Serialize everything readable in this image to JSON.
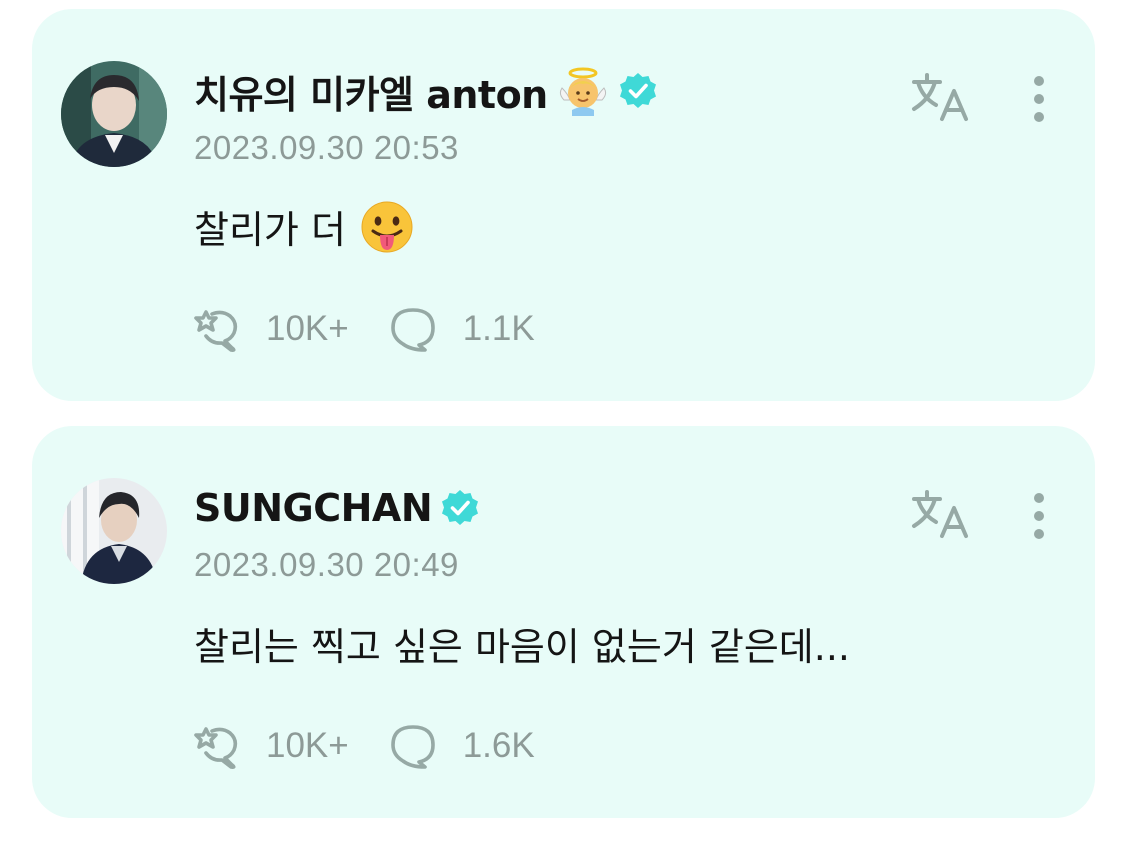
{
  "colors": {
    "card_bg": "#e8fcf8",
    "text_primary": "#151515",
    "text_secondary": "#8d9a97",
    "verified": "#3fd9d7"
  },
  "posts": [
    {
      "author_name": "치유의 미카엘 anton",
      "name_emoji": "angel-baby-emoji",
      "verified": true,
      "timestamp": "2023.09.30 20:53",
      "text": "찰리가 더",
      "text_emoji": "tongue-out-emoji",
      "reactions": "10K+",
      "comments": "1.1K"
    },
    {
      "author_name": "SUNGCHAN",
      "verified": true,
      "timestamp": "2023.09.30 20:49",
      "text": "찰리는 찍고 싶은 마음이 없는거 같은데...",
      "reactions": "10K+",
      "comments": "1.6K"
    }
  ],
  "icons": {
    "translate": "translate-icon",
    "more": "more-options-icon",
    "reaction": "reaction-icon",
    "comment": "comment-icon",
    "verified": "verified-badge-icon"
  }
}
